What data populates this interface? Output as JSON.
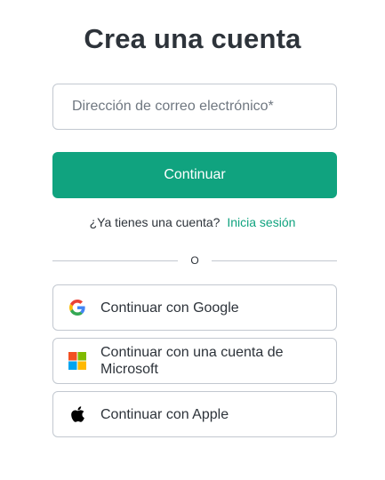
{
  "title": "Crea una cuenta",
  "email": {
    "placeholder": "Dirección de correo electrónico*",
    "value": ""
  },
  "continue_label": "Continuar",
  "login": {
    "prompt": "¿Ya tienes una cuenta?",
    "link_label": "Inicia sesión"
  },
  "divider_label": "O",
  "social": {
    "google": {
      "label": "Continuar con Google",
      "icon": "google-icon"
    },
    "microsoft": {
      "label": "Continuar con una cuenta de Microsoft",
      "icon": "microsoft-icon"
    },
    "apple": {
      "label": "Continuar con Apple",
      "icon": "apple-icon"
    }
  },
  "colors": {
    "accent": "#10a37f",
    "text": "#2d333a",
    "border": "#c2c8d0"
  }
}
